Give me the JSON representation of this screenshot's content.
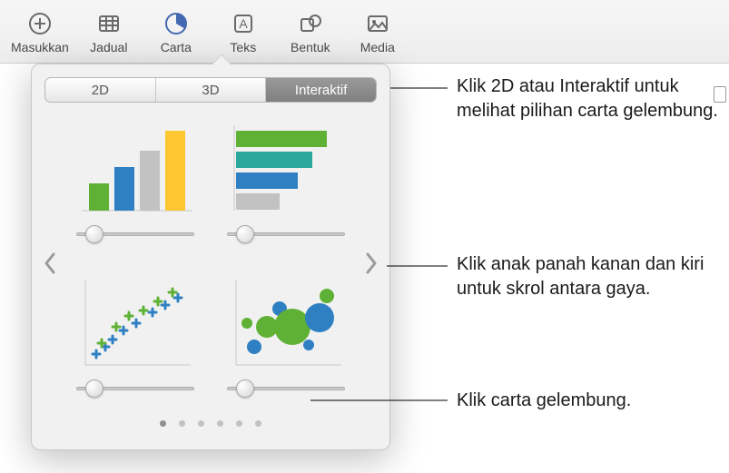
{
  "toolbar": {
    "items": [
      {
        "label": "Masukkan"
      },
      {
        "label": "Jadual"
      },
      {
        "label": "Carta"
      },
      {
        "label": "Teks"
      },
      {
        "label": "Bentuk"
      },
      {
        "label": "Media"
      }
    ]
  },
  "popover": {
    "tabs": [
      {
        "label": "2D"
      },
      {
        "label": "3D"
      },
      {
        "label": "Interaktif"
      }
    ],
    "charts": [
      {
        "name": "column-chart"
      },
      {
        "name": "bar-chart"
      },
      {
        "name": "scatter-chart"
      },
      {
        "name": "bubble-chart"
      }
    ],
    "page_count": 6,
    "active_page": 0
  },
  "callouts": {
    "c1": "Klik 2D atau Interaktif untuk melihat pilihan carta gelembung.",
    "c2": "Klik anak panah kanan dan kiri untuk skrol antara gaya.",
    "c3": "Klik carta gelembung."
  },
  "colors": {
    "green": "#5fb135",
    "blue": "#2f80c3",
    "teal": "#2aa89c",
    "yellow": "#fec631",
    "gray": "#c2c2c2"
  }
}
